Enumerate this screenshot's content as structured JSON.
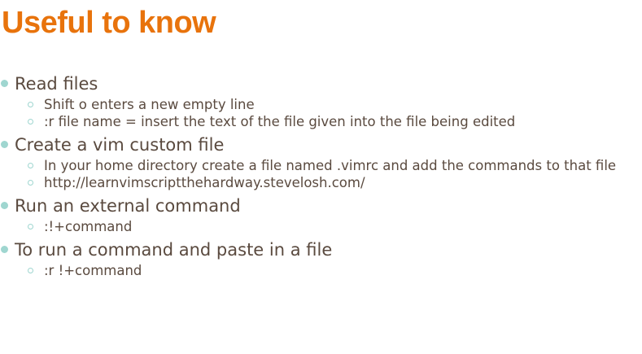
{
  "slide": {
    "title": "Useful to know",
    "accent_color": "#e8730c",
    "bullet_color": "#9fd6d0",
    "sections": [
      {
        "heading": "Read files",
        "items": [
          "Shift o enters a new empty line",
          ":r file name = insert the text of the file given into the file being edited"
        ]
      },
      {
        "heading": "Create a vim custom file",
        "items": [
          "In your home directory create a file named .vimrc and add the commands to that file",
          "http://learnvimscriptthehardway.stevelosh.com/"
        ]
      },
      {
        "heading": "Run an external command",
        "items": [
          ":!+command"
        ]
      },
      {
        "heading": "To run a command and paste in a file",
        "items": [
          ":r !+command"
        ]
      }
    ]
  }
}
